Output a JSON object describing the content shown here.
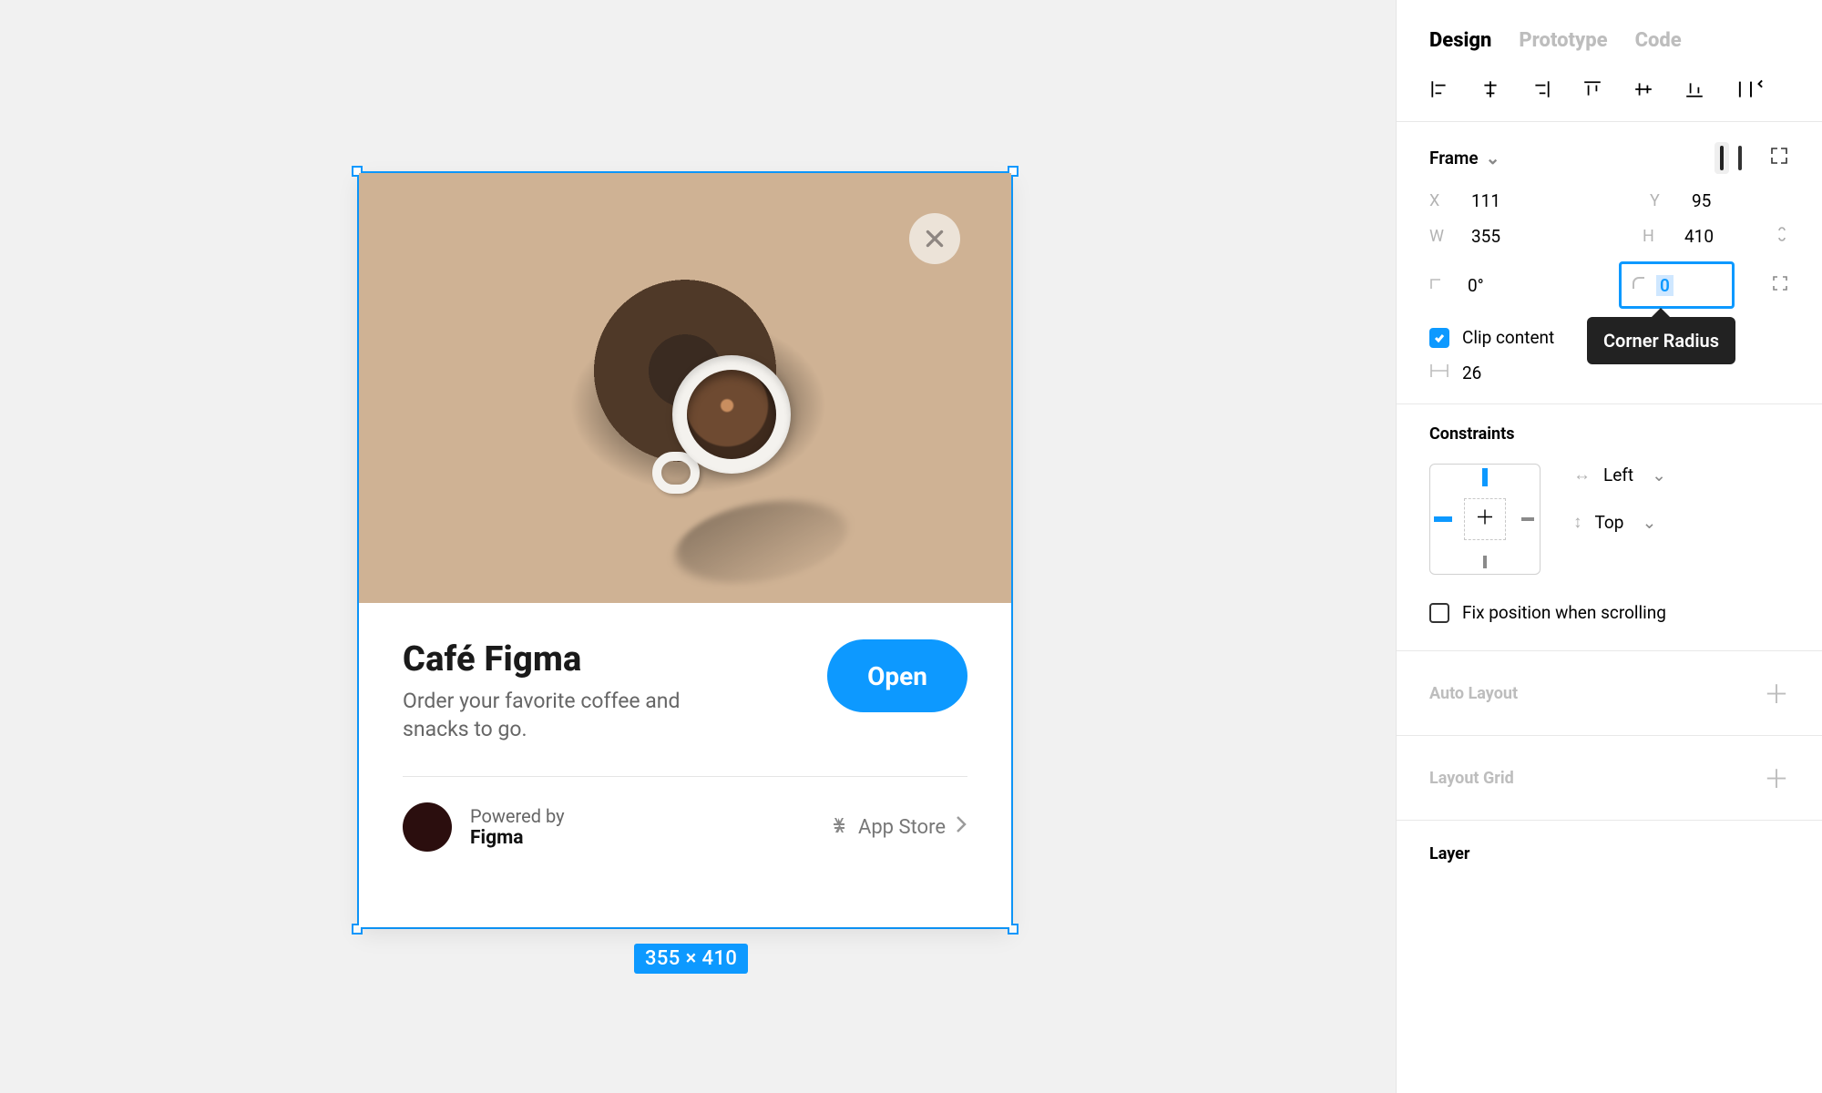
{
  "canvas": {
    "selected_dimensions_label": "355 × 410",
    "frame": {
      "close_button_label": "close",
      "title": "Café Figma",
      "description": "Order your favorite coffee and snacks to go.",
      "open_button_label": "Open",
      "powered_by_label": "Powered by",
      "brand": "Figma",
      "store_label": "App Store"
    }
  },
  "panel": {
    "tabs": {
      "design": "Design",
      "prototype": "Prototype",
      "code": "Code"
    },
    "frame_section": {
      "type_label": "Frame",
      "x_label": "X",
      "x_value": "111",
      "y_label": "Y",
      "y_value": "95",
      "w_label": "W",
      "w_value": "355",
      "h_label": "H",
      "h_value": "410",
      "rotation_label": "0°",
      "corner_radius_value": "0",
      "corner_radius_tooltip": "Corner Radius",
      "clip_label": "Clip content",
      "spacing_value": "26"
    },
    "constraints": {
      "title": "Constraints",
      "horizontal": "Left",
      "vertical": "Top",
      "fix_label": "Fix position when scrolling"
    },
    "auto_layout_title": "Auto Layout",
    "layout_grid_title": "Layout Grid",
    "layer_title": "Layer"
  }
}
